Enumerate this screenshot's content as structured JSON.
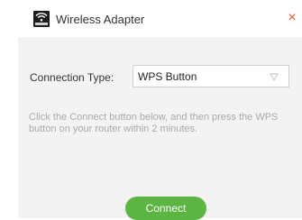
{
  "window": {
    "title": "Wireless Adapter",
    "icon": "wifi-adapter-icon",
    "close_icon": "close-icon",
    "close_symbol": "×"
  },
  "connection": {
    "label": "Connection Type:",
    "selected": "WPS Button"
  },
  "instructions": "Click the Connect button below, and then press the WPS button on your router within 2 minutes.",
  "connect_button": "Connect",
  "colors": {
    "accent": "#5cb542",
    "close": "#e05a2b",
    "panel": "#f3f3f3",
    "hint_text": "#aaaaaa"
  }
}
